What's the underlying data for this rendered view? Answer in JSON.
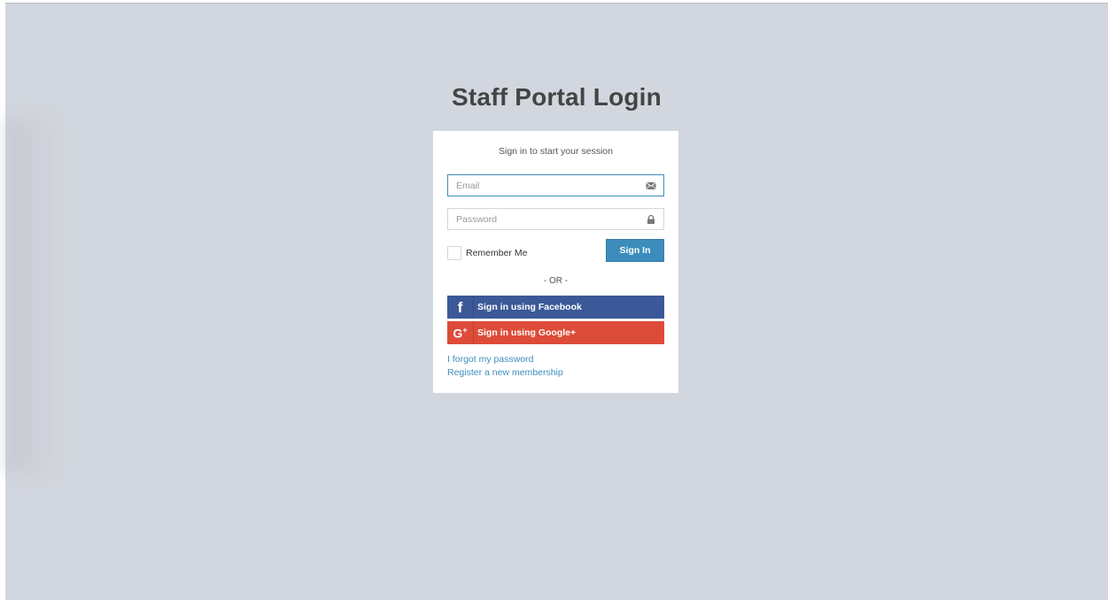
{
  "page": {
    "title": "Staff Portal Login",
    "background_color": "#d2d6de"
  },
  "login_box": {
    "message": "Sign in to start your session",
    "email": {
      "placeholder": "Email",
      "value": "",
      "icon": "envelope-icon"
    },
    "password": {
      "placeholder": "Password",
      "value": "",
      "icon": "lock-icon"
    },
    "remember_label": "Remember Me",
    "remember_checked": false,
    "sign_in_label": "Sign In",
    "separator": "- OR -",
    "facebook_label": "Sign in using Facebook",
    "google_label": "Sign in using Google+",
    "forgot_link": "I forgot my password",
    "register_link": "Register a new membership"
  },
  "colors": {
    "primary": "#3c8dbc",
    "facebook": "#3b5998",
    "google": "#dd4b39",
    "title_text": "#444444"
  }
}
